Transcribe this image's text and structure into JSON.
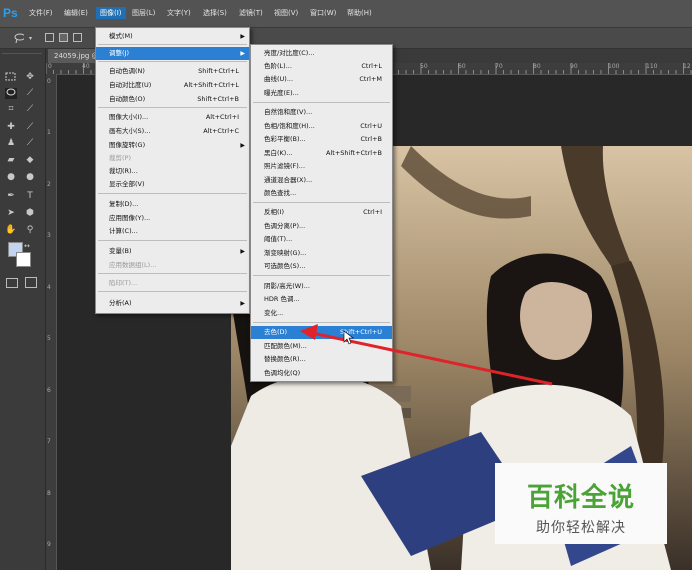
{
  "app": {
    "logo": "Ps"
  },
  "menubar": [
    {
      "label": "文件(F)"
    },
    {
      "label": "编辑(E)"
    },
    {
      "label": "图像(I)"
    },
    {
      "label": "图层(L)"
    },
    {
      "label": "文字(Y)"
    },
    {
      "label": "选择(S)"
    },
    {
      "label": "滤镜(T)"
    },
    {
      "label": "视图(V)"
    },
    {
      "label": "窗口(W)"
    },
    {
      "label": "帮助(H)"
    }
  ],
  "document": {
    "tab_label": "24059.jpg @"
  },
  "ruler_top": [
    "0",
    "40",
    "50",
    "60",
    "70",
    "80",
    "90",
    "100",
    "110",
    "12"
  ],
  "ruler_left": [
    "0",
    "1",
    "2",
    "3",
    "4",
    "5",
    "6",
    "7",
    "8",
    "9"
  ],
  "image_menu": {
    "items": [
      {
        "label": "模式(M)",
        "shortcut": ""
      },
      {
        "label": "调整(J)",
        "shortcut": ""
      },
      {
        "label": "自动色调(N)",
        "shortcut": "Shift+Ctrl+L"
      },
      {
        "label": "自动对比度(U)",
        "shortcut": "Alt+Shift+Ctrl+L"
      },
      {
        "label": "自动颜色(O)",
        "shortcut": "Shift+Ctrl+B"
      },
      {
        "label": "图像大小(I)...",
        "shortcut": "Alt+Ctrl+I"
      },
      {
        "label": "画布大小(S)...",
        "shortcut": "Alt+Ctrl+C"
      },
      {
        "label": "图像旋转(G)",
        "shortcut": ""
      },
      {
        "label": "裁剪(P)",
        "shortcut": ""
      },
      {
        "label": "裁切(R)...",
        "shortcut": ""
      },
      {
        "label": "显示全部(V)",
        "shortcut": ""
      },
      {
        "label": "复制(D)...",
        "shortcut": ""
      },
      {
        "label": "应用图像(Y)...",
        "shortcut": ""
      },
      {
        "label": "计算(C)...",
        "shortcut": ""
      },
      {
        "label": "变量(B)",
        "shortcut": ""
      },
      {
        "label": "应用数据组(L)...",
        "shortcut": ""
      },
      {
        "label": "陷印(T)...",
        "shortcut": ""
      },
      {
        "label": "分析(A)",
        "shortcut": ""
      }
    ]
  },
  "adjust_menu": {
    "items": [
      {
        "label": "亮度/对比度(C)...",
        "shortcut": ""
      },
      {
        "label": "色阶(L)...",
        "shortcut": "Ctrl+L"
      },
      {
        "label": "曲线(U)...",
        "shortcut": "Ctrl+M"
      },
      {
        "label": "曝光度(E)...",
        "shortcut": ""
      },
      {
        "label": "自然饱和度(V)...",
        "shortcut": ""
      },
      {
        "label": "色相/饱和度(H)...",
        "shortcut": "Ctrl+U"
      },
      {
        "label": "色彩平衡(B)...",
        "shortcut": "Ctrl+B"
      },
      {
        "label": "黑白(K)...",
        "shortcut": "Alt+Shift+Ctrl+B"
      },
      {
        "label": "照片滤镜(F)...",
        "shortcut": ""
      },
      {
        "label": "通道混合器(X)...",
        "shortcut": ""
      },
      {
        "label": "颜色查找...",
        "shortcut": ""
      },
      {
        "label": "反相(I)",
        "shortcut": "Ctrl+I"
      },
      {
        "label": "色调分离(P)...",
        "shortcut": ""
      },
      {
        "label": "阈值(T)...",
        "shortcut": ""
      },
      {
        "label": "渐变映射(G)...",
        "shortcut": ""
      },
      {
        "label": "可选颜色(S)...",
        "shortcut": ""
      },
      {
        "label": "阴影/高光(W)...",
        "shortcut": ""
      },
      {
        "label": "HDR 色调...",
        "shortcut": ""
      },
      {
        "label": "变化...",
        "shortcut": ""
      },
      {
        "label": "去色(D)",
        "shortcut": "Shift+Ctrl+U"
      },
      {
        "label": "匹配颜色(M)...",
        "shortcut": ""
      },
      {
        "label": "替换颜色(R)...",
        "shortcut": ""
      },
      {
        "label": "色调均化(Q)",
        "shortcut": ""
      }
    ]
  },
  "watermark": {
    "title": "百科全说",
    "subtitle": "助你轻松解决"
  },
  "colors": {
    "accent": "#2b80d4",
    "annotation_arrow": "#e0222a",
    "watermark_green": "#4aa336"
  }
}
